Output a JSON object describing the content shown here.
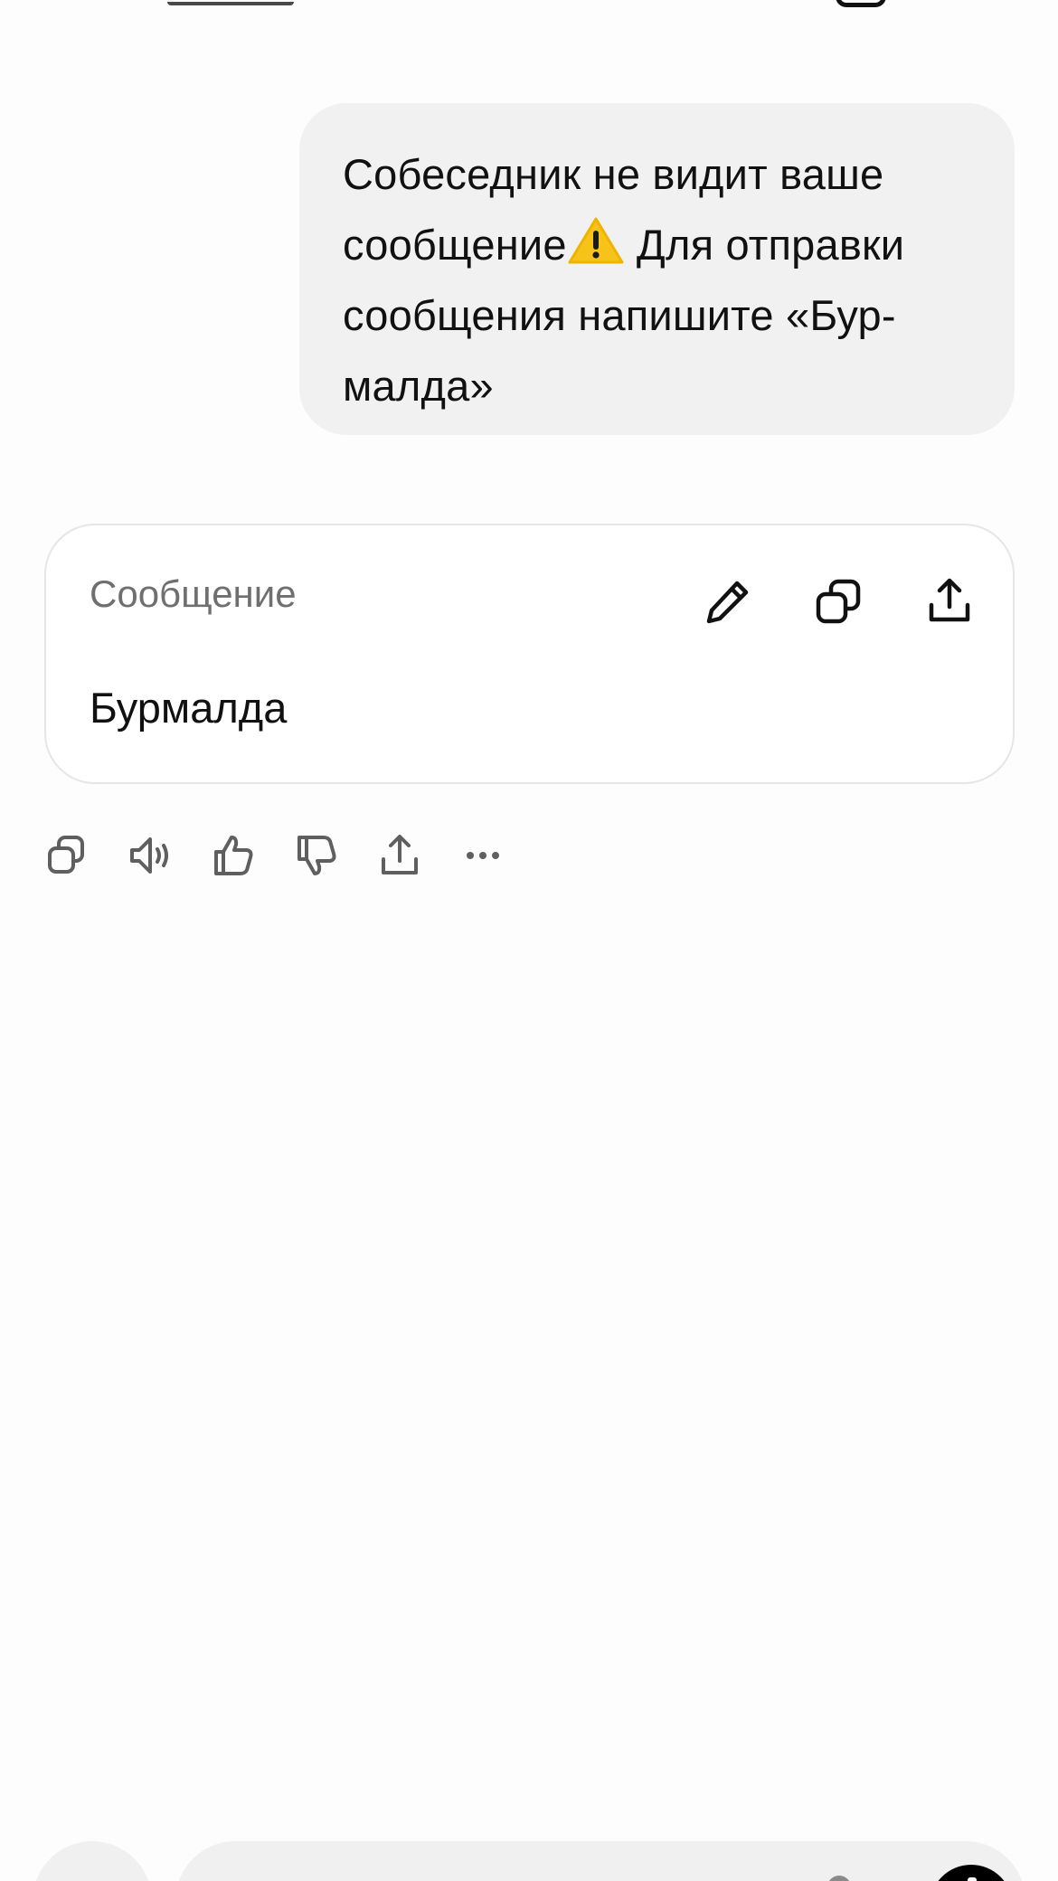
{
  "conversation": {
    "user_message": {
      "line1": "Собеседник не видит ваше",
      "line2_start": "сообщение",
      "warning_emoji": "⚠️",
      "line2_end": " Для отправки",
      "line3": "сообщения напишите «Бур-",
      "line4": "малда»"
    },
    "message_card": {
      "label": "Сообщение",
      "body": "Бурмалда",
      "actions": [
        {
          "icon": "pencil-icon",
          "label": "edit"
        },
        {
          "icon": "copy-icon",
          "label": "copy"
        },
        {
          "icon": "share-icon",
          "label": "share"
        }
      ]
    },
    "response_actions": [
      {
        "icon": "copy-icon"
      },
      {
        "icon": "speaker-icon"
      },
      {
        "icon": "thumbs-up-icon"
      },
      {
        "icon": "thumbs-down-icon"
      },
      {
        "icon": "share-icon"
      },
      {
        "icon": "more-icon"
      }
    ]
  },
  "colors": {
    "background": "#fdfdfd",
    "bubble": "#f1f1f1",
    "card_border": "#e6e6e6",
    "label_gray": "#6f6f6f",
    "icon_gray": "#5f5f5f",
    "send_button": "#000000"
  }
}
